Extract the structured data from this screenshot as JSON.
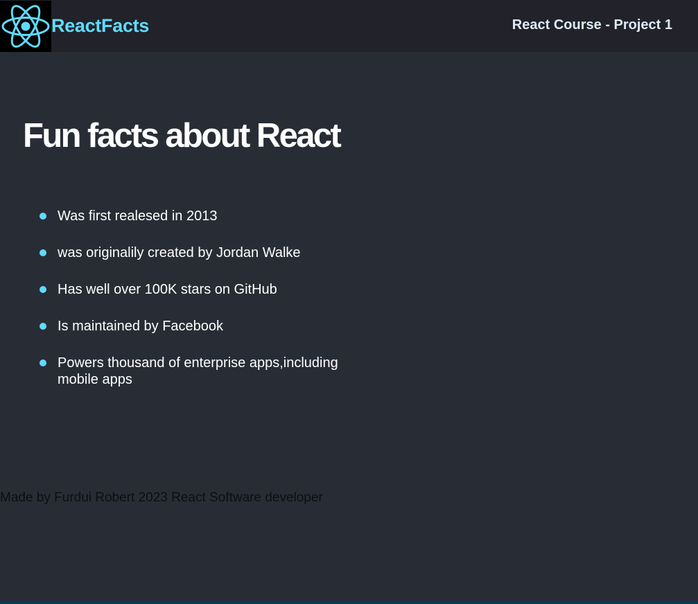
{
  "navbar": {
    "logo_icon": "react-atom-icon",
    "brand": "ReactFacts",
    "subtitle": "React Course - Project 1"
  },
  "main": {
    "title": "Fun facts about React",
    "facts": [
      "Was first realesed in 2013",
      "was originalily created by Jordan Walke",
      "Has well over 100K stars on GitHub",
      "Is maintained by Facebook",
      "Powers thousand of enterprise apps,including mobile apps"
    ]
  },
  "footer": {
    "text": "Made by Furdui Robert 2023 React Software developer"
  },
  "colors": {
    "accent": "#61dafb",
    "navbar_bg": "#21222a",
    "page_bg": "#282d35"
  }
}
